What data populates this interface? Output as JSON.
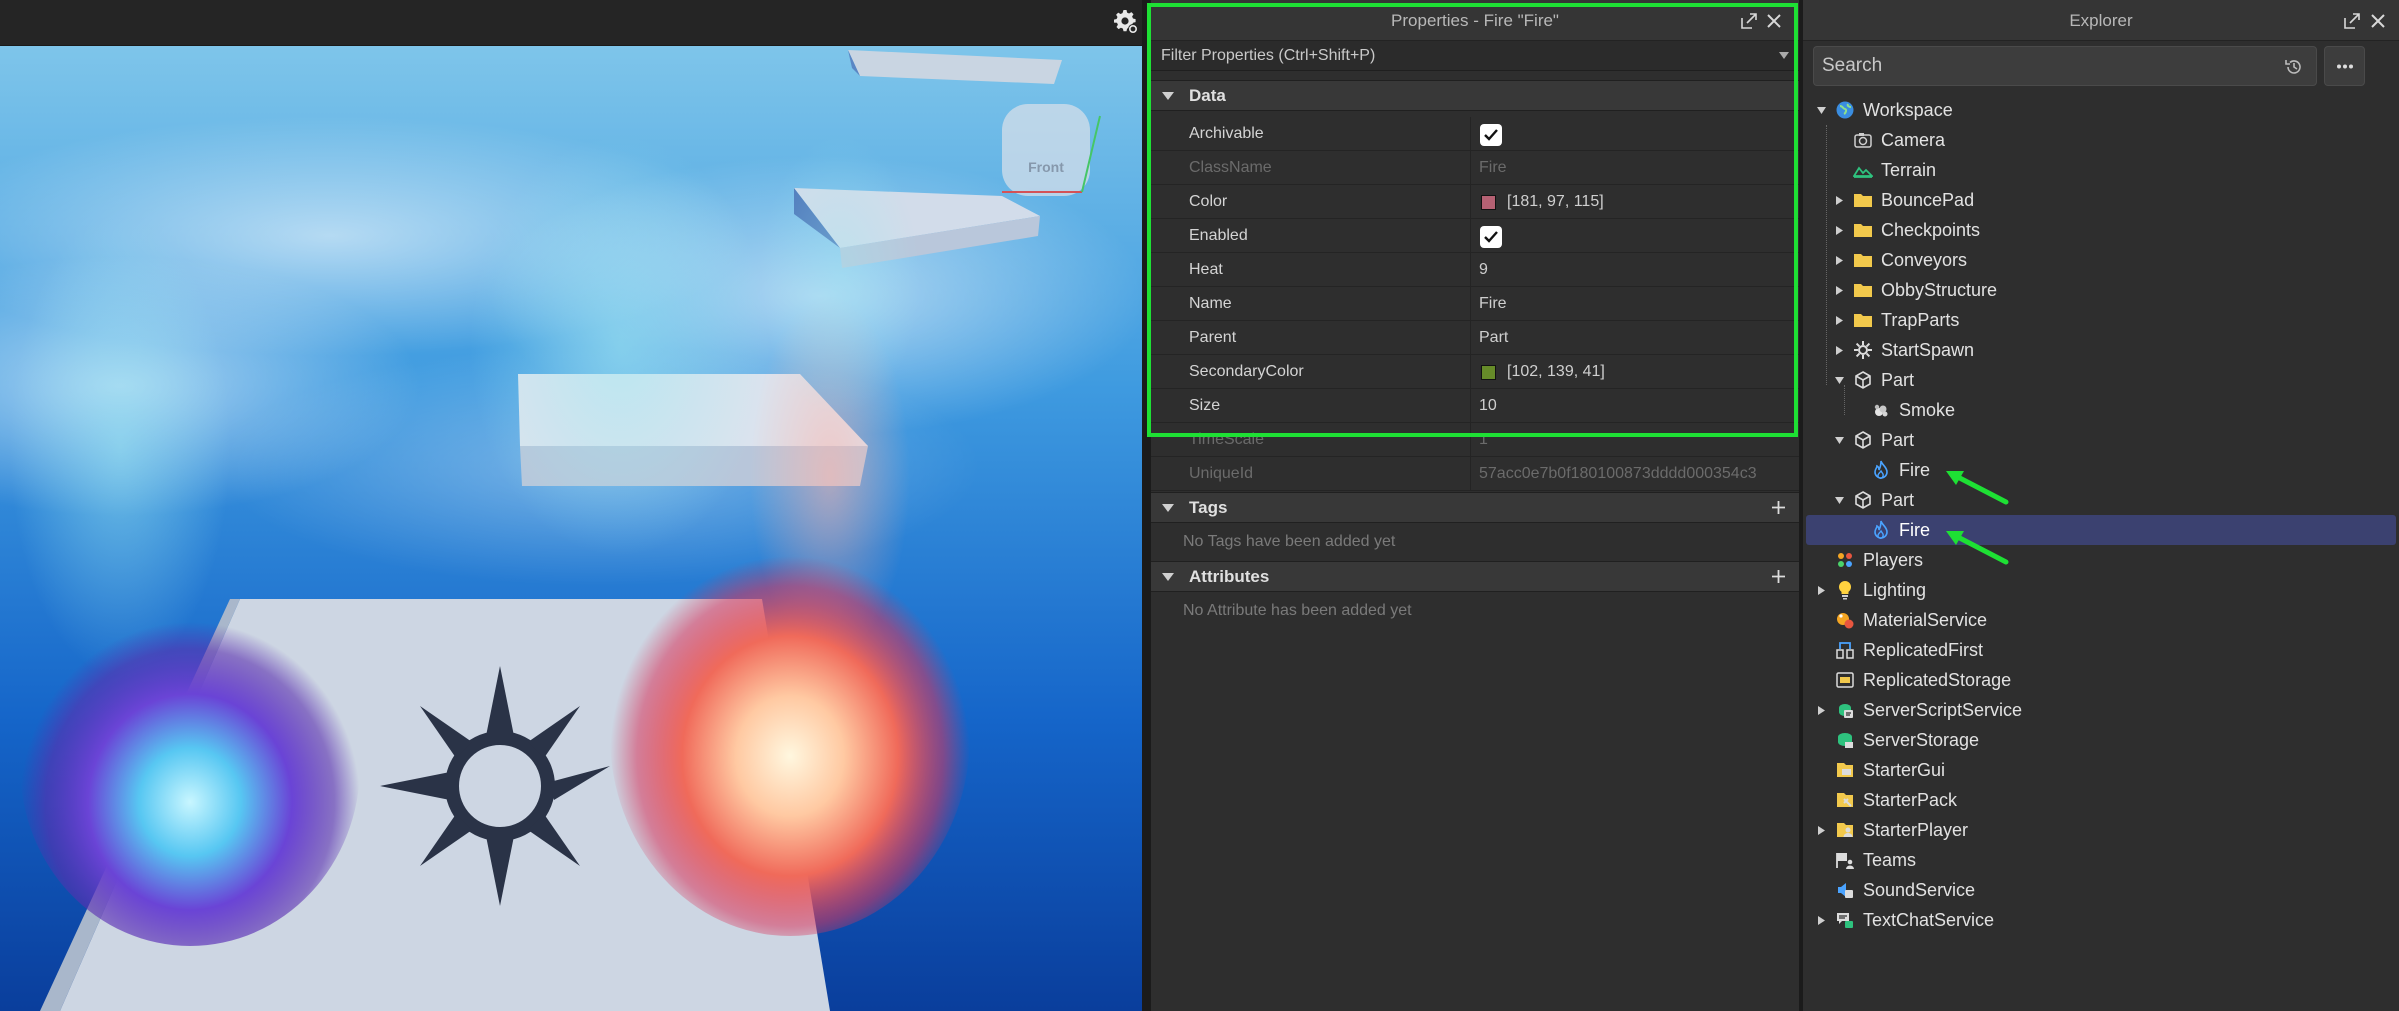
{
  "viewport": {
    "gizmo_face_label": "Front",
    "settings_icon": "gear-icon"
  },
  "properties": {
    "title": "Properties - Fire \"Fire\"",
    "filter_label": "Filter Properties (Ctrl+Shift+P)",
    "sections": {
      "data": "Data",
      "tags": "Tags",
      "attributes": "Attributes"
    },
    "rows": {
      "archivable": {
        "name": "Archivable",
        "checked": true
      },
      "classname": {
        "name": "ClassName",
        "value": "Fire"
      },
      "color": {
        "name": "Color",
        "value": "[181, 97, 115]",
        "swatch": "#b56173"
      },
      "enabled": {
        "name": "Enabled",
        "checked": true
      },
      "heat": {
        "name": "Heat",
        "value": "9"
      },
      "name": {
        "name": "Name",
        "value": "Fire"
      },
      "parent": {
        "name": "Parent",
        "value": "Part"
      },
      "secondarycolor": {
        "name": "SecondaryColor",
        "value": "[102, 139, 41]",
        "swatch": "#668b29"
      },
      "size": {
        "name": "Size",
        "value": "10"
      },
      "timescale": {
        "name": "TimeScale",
        "value": "1"
      },
      "uniqueid": {
        "name": "UniqueId",
        "value": "57acc0e7b0f180100873dddd000354c3"
      }
    },
    "tags_empty": "No Tags have been added yet",
    "attributes_empty": "No Attribute has been added yet"
  },
  "explorer": {
    "title": "Explorer",
    "search_placeholder": "Search",
    "items": [
      {
        "label": "Workspace",
        "icon": "globe-icon"
      },
      {
        "label": "Camera",
        "icon": "camera-icon"
      },
      {
        "label": "Terrain",
        "icon": "terrain-icon"
      },
      {
        "label": "BouncePad",
        "icon": "folder-icon"
      },
      {
        "label": "Checkpoints",
        "icon": "folder-icon"
      },
      {
        "label": "Conveyors",
        "icon": "folder-icon"
      },
      {
        "label": "ObbyStructure",
        "icon": "folder-icon"
      },
      {
        "label": "TrapParts",
        "icon": "folder-icon"
      },
      {
        "label": "StartSpawn",
        "icon": "spawn-icon"
      },
      {
        "label": "Part",
        "icon": "part-icon"
      },
      {
        "label": "Smoke",
        "icon": "smoke-icon"
      },
      {
        "label": "Part",
        "icon": "part-icon"
      },
      {
        "label": "Fire",
        "icon": "fire-icon"
      },
      {
        "label": "Part",
        "icon": "part-icon"
      },
      {
        "label": "Fire",
        "icon": "fire-icon"
      },
      {
        "label": "Players",
        "icon": "players-icon"
      },
      {
        "label": "Lighting",
        "icon": "lighting-icon"
      },
      {
        "label": "MaterialService",
        "icon": "material-service-icon"
      },
      {
        "label": "ReplicatedFirst",
        "icon": "replicated-first-icon"
      },
      {
        "label": "ReplicatedStorage",
        "icon": "replicated-storage-icon"
      },
      {
        "label": "ServerScriptService",
        "icon": "server-script-service-icon"
      },
      {
        "label": "ServerStorage",
        "icon": "server-storage-icon"
      },
      {
        "label": "StarterGui",
        "icon": "starter-gui-icon"
      },
      {
        "label": "StarterPack",
        "icon": "starter-pack-icon"
      },
      {
        "label": "StarterPlayer",
        "icon": "starter-player-icon"
      },
      {
        "label": "Teams",
        "icon": "teams-icon"
      },
      {
        "label": "SoundService",
        "icon": "sound-service-icon"
      },
      {
        "label": "TextChatService",
        "icon": "text-chat-service-icon"
      }
    ]
  },
  "colors": {
    "highlight": "#1ee034",
    "selection": "#3b4170",
    "panel_bg": "#2e2e2e"
  }
}
